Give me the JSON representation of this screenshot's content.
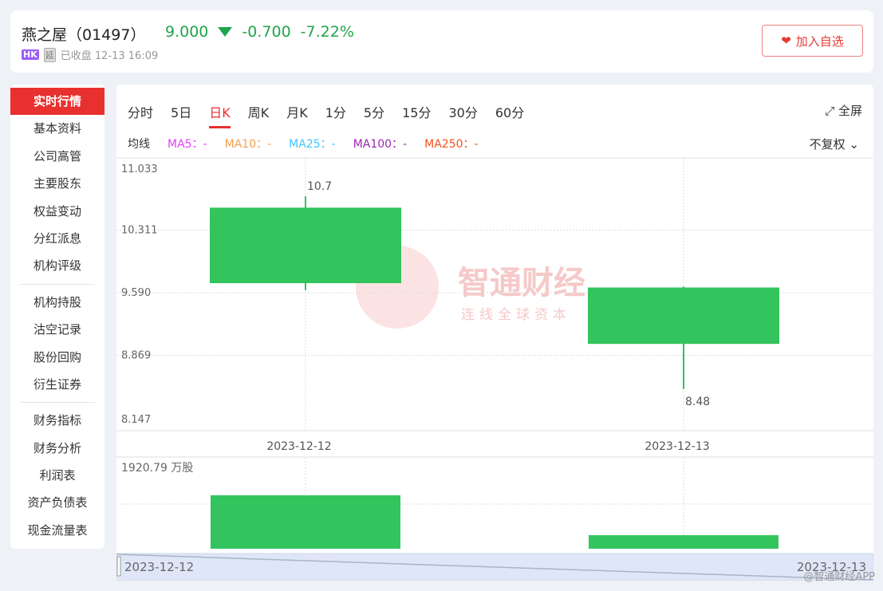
{
  "header": {
    "name": "燕之屋（01497）",
    "price": "9.000",
    "change": "-0.700",
    "change_pct": "-7.22%",
    "market_badge": "HK",
    "delay_badge": "延",
    "status": "已收盘 12-13 16:09",
    "fav_label": "加入自选"
  },
  "sidebar": {
    "items": [
      {
        "label": "实时行情"
      },
      {
        "label": "基本资料"
      },
      {
        "label": "公司高管"
      },
      {
        "label": "主要股东"
      },
      {
        "label": "权益变动"
      },
      {
        "label": "分红派息"
      },
      {
        "label": "机构评级"
      },
      {
        "label": "机构持股"
      },
      {
        "label": "沽空记录"
      },
      {
        "label": "股份回购"
      },
      {
        "label": "衍生证券"
      },
      {
        "label": "财务指标"
      },
      {
        "label": "财务分析"
      },
      {
        "label": "利润表"
      },
      {
        "label": "资产负债表"
      },
      {
        "label": "现金流量表"
      }
    ]
  },
  "tabs": [
    "分时",
    "5日",
    "日K",
    "周K",
    "月K",
    "1分",
    "5分",
    "15分",
    "30分",
    "60分"
  ],
  "fullscreen": "全屏",
  "ma": {
    "label": "均线",
    "items": [
      {
        "t": "MA5：-",
        "c": "#e040fb"
      },
      {
        "t": "MA10：-",
        "c": "#f5a04a"
      },
      {
        "t": "MA25：-",
        "c": "#40c4ff"
      },
      {
        "t": "MA100：-",
        "c": "#9c27b0"
      },
      {
        "t": "MA250：-",
        "c": "#f4511e"
      }
    ]
  },
  "adjust": "不复权",
  "watermark": {
    "title": "智通财经",
    "slogan": "连线全球资本"
  },
  "credit": "@智通财经APP",
  "chart_data": {
    "type": "candlestick",
    "y_ticks": [
      "11.033",
      "10.311",
      "9.590",
      "8.869",
      "8.147"
    ],
    "ylim": [
      8.147,
      11.033
    ],
    "candles": [
      {
        "date": "2023-12-12",
        "open": 10.57,
        "close": 9.7,
        "high": 10.7,
        "low": 9.62,
        "high_label": "10.7"
      },
      {
        "date": "2023-12-13",
        "open": 9.65,
        "close": 9.0,
        "high": 9.66,
        "low": 8.48,
        "low_label": "8.48"
      }
    ],
    "volume": {
      "unit_label": "1920.79 万股",
      "max": 1920.79,
      "values": [
        1214,
        308
      ]
    },
    "range": {
      "start": "2023-12-12",
      "end": "2023-12-13"
    }
  }
}
